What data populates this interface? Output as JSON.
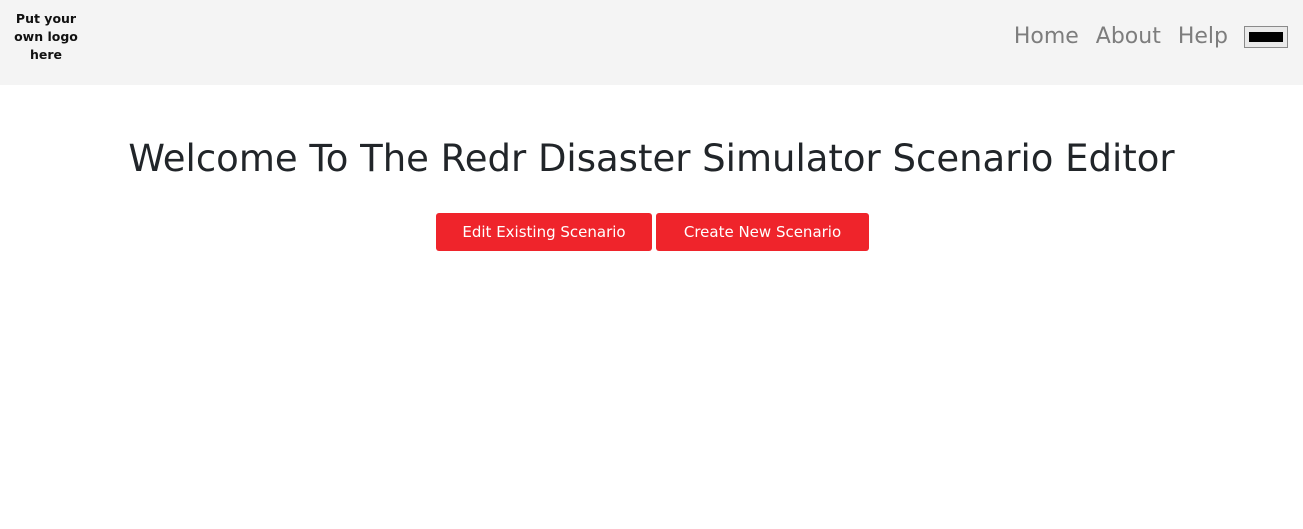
{
  "header": {
    "logo_text": "Put your\nown logo\nhere",
    "nav": [
      {
        "label": "Home"
      },
      {
        "label": "About"
      },
      {
        "label": "Help"
      }
    ],
    "menu_icon": "menu-toggle-icon"
  },
  "main": {
    "title": "Welcome To The Redr Disaster Simulator Scenario Editor",
    "buttons": {
      "edit_label": "Edit Existing Scenario",
      "create_label": "Create New Scenario"
    }
  },
  "colors": {
    "navbar_bg": "#f4f4f4",
    "button_bg": "#ef242b",
    "nav_link": "#7d7d7d",
    "title_text": "#212529"
  }
}
